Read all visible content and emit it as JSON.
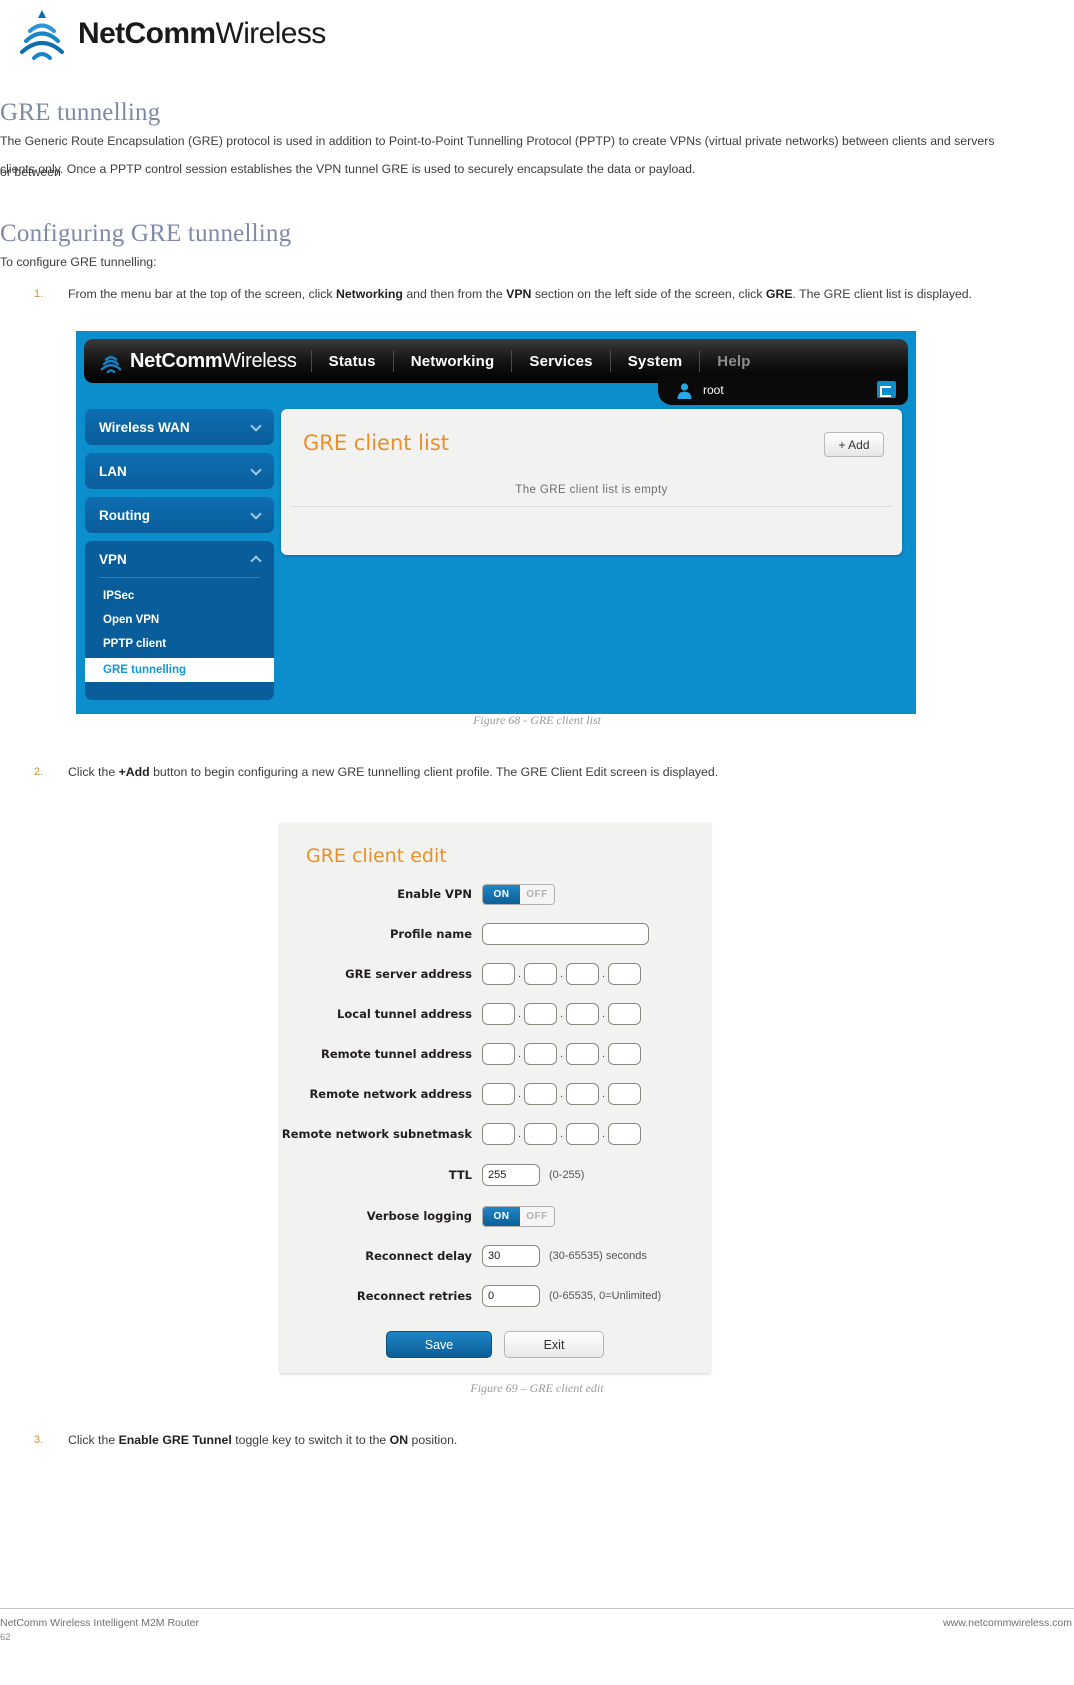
{
  "brand": {
    "name_bold": "NetComm",
    "name_light": "Wireless",
    "logo_icon": "wifi-fan-logo-icon"
  },
  "headings": {
    "h1": "GRE tunnelling",
    "h2": "Configuring GRE tunnelling"
  },
  "intro": {
    "line1": "The Generic Route Encapsulation (GRE) protocol is used in addition to Point-to-Point Tunnelling Protocol (PPTP) to create VPNs (virtual private networks) between clients and servers or between",
    "line2": "clients only. Once a PPTP control session establishes the VPN tunnel GRE is used to securely encapsulate the data or payload."
  },
  "lead_in": "To configure GRE tunnelling:",
  "steps": [
    {
      "num": "1.",
      "a": "From the menu bar at the top of the screen, click ",
      "b1": "Networking",
      "c": " and then from the ",
      "b2": "VPN",
      "d": " section on the left side of the screen, click ",
      "b3": "GRE",
      "e": ". The GRE client list is displayed."
    },
    {
      "num": "2.",
      "a": "Click the ",
      "b1": "+Add",
      "c": " button to begin configuring a new GRE tunnelling client profile. The GRE Client Edit screen is displayed."
    },
    {
      "num": "3.",
      "a": "Click the ",
      "b1": "Enable GRE Tunnel",
      "c": " toggle key to switch it to the ",
      "b2": "ON",
      "d": " position."
    }
  ],
  "figure_captions": {
    "fig68": "Figure 68 - GRE client list",
    "fig69": "Figure 69 – GRE client edit"
  },
  "router_ui_list": {
    "nav": [
      {
        "label": "Status",
        "dim": false
      },
      {
        "label": "Networking",
        "dim": false
      },
      {
        "label": "Services",
        "dim": false
      },
      {
        "label": "System",
        "dim": false
      },
      {
        "label": "Help",
        "dim": true
      }
    ],
    "user": {
      "name": "root",
      "icon": "user-avatar-icon",
      "logout_icon": "logout-arrow-icon"
    },
    "sidebar": [
      {
        "label": "Wireless WAN",
        "state": "collapsed"
      },
      {
        "label": "LAN",
        "state": "collapsed"
      },
      {
        "label": "Routing",
        "state": "collapsed"
      },
      {
        "label": "VPN",
        "state": "expanded"
      }
    ],
    "vpn_sub_items": [
      {
        "label": "IPSec",
        "active": false
      },
      {
        "label": "Open VPN",
        "active": false
      },
      {
        "label": "PPTP client",
        "active": false
      },
      {
        "label": "GRE tunnelling",
        "active": true
      }
    ],
    "card": {
      "title": "GRE client list",
      "add_button": "+  Add",
      "empty_message": "The GRE client list is empty"
    },
    "colors": {
      "page_blue": "#0b8ecb",
      "sidebar_blue": "#0a5d9b",
      "accent_orange": "#e8912a"
    }
  },
  "router_ui_edit": {
    "title": "GRE client edit",
    "fields": [
      {
        "label": "Enable VPN",
        "type": "toggle",
        "on_label": "ON",
        "off_label": "OFF",
        "value": "ON"
      },
      {
        "label": "Profile name",
        "type": "text",
        "value": ""
      },
      {
        "label": "GRE server address",
        "type": "ip",
        "value": [
          "",
          "",
          "",
          ""
        ]
      },
      {
        "label": "Local tunnel address",
        "type": "ip",
        "value": [
          "",
          "",
          "",
          ""
        ]
      },
      {
        "label": "Remote tunnel address",
        "type": "ip",
        "value": [
          "",
          "",
          "",
          ""
        ]
      },
      {
        "label": "Remote network address",
        "type": "ip",
        "value": [
          "",
          "",
          "",
          ""
        ]
      },
      {
        "label": "Remote network subnetmask",
        "type": "ip",
        "value": [
          "",
          "",
          "",
          ""
        ]
      },
      {
        "label": "TTL",
        "type": "num",
        "value": "255",
        "hint": "(0-255)"
      },
      {
        "label": "Verbose logging",
        "type": "toggle",
        "on_label": "ON",
        "off_label": "OFF",
        "value": "ON"
      },
      {
        "label": "Reconnect delay",
        "type": "num",
        "value": "30",
        "hint": "(30-65535) seconds"
      },
      {
        "label": "Reconnect retries",
        "type": "num",
        "value": "0",
        "hint": "(0-65535, 0=Unlimited)"
      }
    ],
    "buttons": {
      "save": "Save",
      "exit": "Exit"
    }
  },
  "footer": {
    "left": "NetComm Wireless Intelligent M2M Router",
    "right": "www.netcommwireless.com",
    "page": "62"
  }
}
